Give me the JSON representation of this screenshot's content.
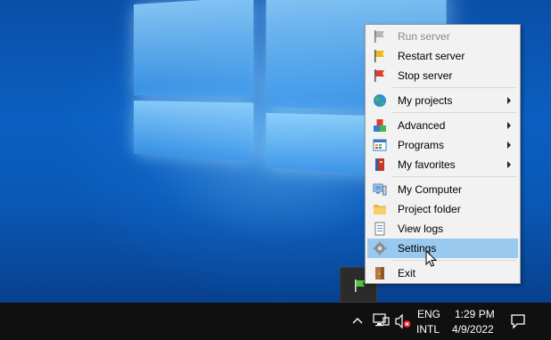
{
  "menu": {
    "items": [
      {
        "label": "Run server",
        "icon": "flag-gray-icon",
        "disabled": true
      },
      {
        "label": "Restart server",
        "icon": "flag-yellow-icon"
      },
      {
        "label": "Stop server",
        "icon": "flag-red-icon"
      },
      {
        "label": "My projects",
        "icon": "globe-icon",
        "submenu": true
      },
      {
        "label": "Advanced",
        "icon": "blocks-icon",
        "submenu": true
      },
      {
        "label": "Programs",
        "icon": "programs-window-icon",
        "submenu": true
      },
      {
        "label": "My favorites",
        "icon": "book-icon",
        "submenu": true
      },
      {
        "label": "My Computer",
        "icon": "computer-icon"
      },
      {
        "label": "Project folder",
        "icon": "folder-icon"
      },
      {
        "label": "View logs",
        "icon": "log-file-icon"
      },
      {
        "label": "Settings",
        "icon": "gear-icon",
        "highlighted": true
      },
      {
        "label": "Exit",
        "icon": "door-exit-icon"
      }
    ]
  },
  "taskbar": {
    "language_top": "ENG",
    "language_bottom": "INTL",
    "time": "1:29 PM",
    "date": "4/9/2022"
  },
  "colors": {
    "highlight": "#99c9ef",
    "taskbar": "#101010",
    "menu_bg": "#f2f2f2"
  }
}
